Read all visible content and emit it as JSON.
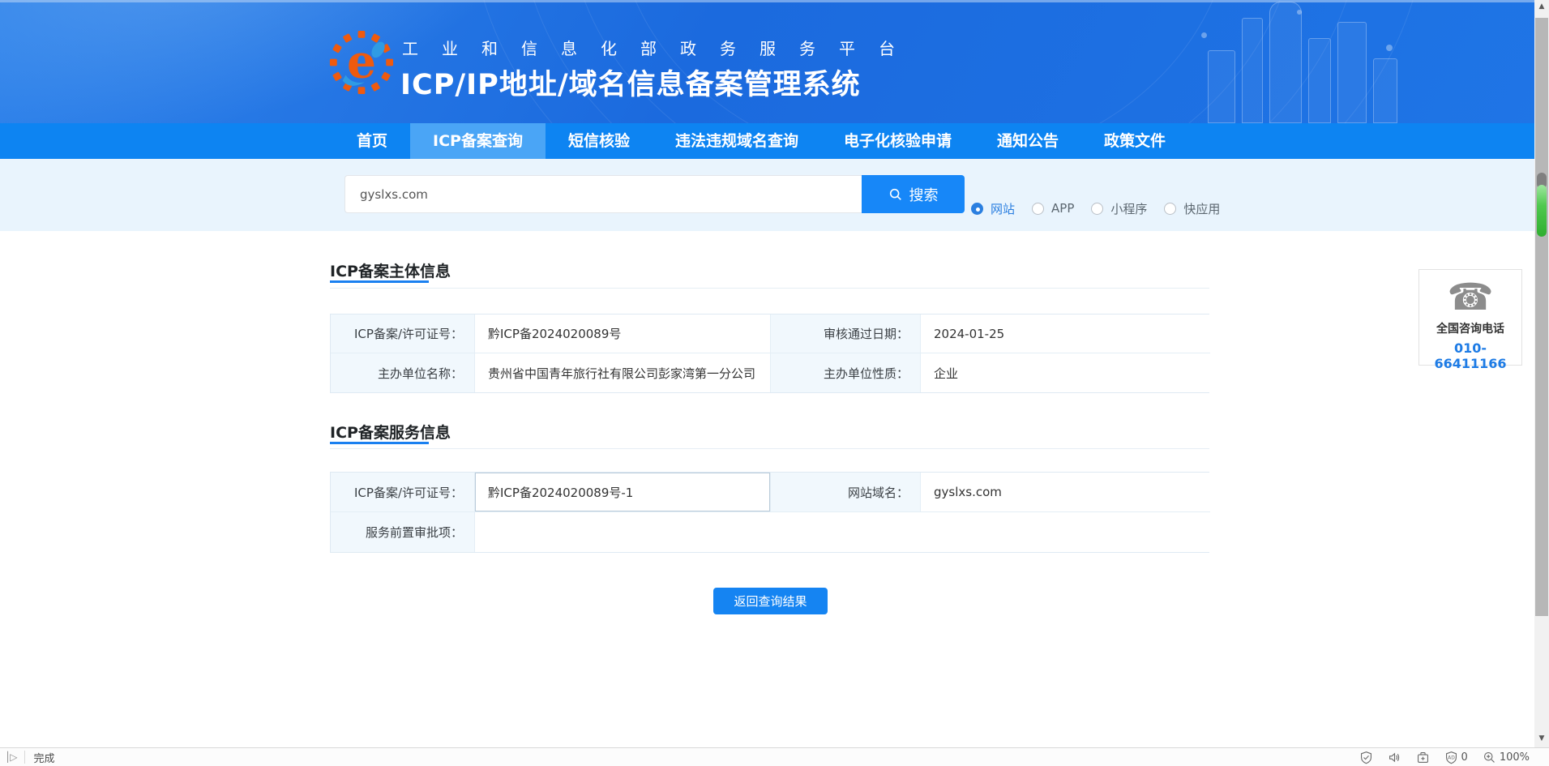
{
  "header": {
    "platform_text": "工业和信息化部政务服务平台",
    "title": "ICP/IP地址/域名信息备案管理系统"
  },
  "nav": {
    "items": [
      {
        "label": "首页",
        "active": false
      },
      {
        "label": "ICP备案查询",
        "active": true
      },
      {
        "label": "短信核验",
        "active": false
      },
      {
        "label": "违法违规域名查询",
        "active": false
      },
      {
        "label": "电子化核验申请",
        "active": false
      },
      {
        "label": "通知公告",
        "active": false
      },
      {
        "label": "政策文件",
        "active": false
      }
    ]
  },
  "search": {
    "value": "gyslxs.com",
    "button_label": "搜索",
    "types": [
      {
        "label": "网站",
        "selected": true
      },
      {
        "label": "APP",
        "selected": false
      },
      {
        "label": "小程序",
        "selected": false
      },
      {
        "label": "快应用",
        "selected": false
      }
    ]
  },
  "subject_info": {
    "title": "ICP备案主体信息",
    "license_label": "ICP备案/许可证号：",
    "license_value": "黔ICP备2024020089号",
    "audit_date_label": "审核通过日期：",
    "audit_date_value": "2024-01-25",
    "org_name_label": "主办单位名称：",
    "org_name_value": "贵州省中国青年旅行社有限公司彭家湾第一分公司",
    "org_nature_label": "主办单位性质：",
    "org_nature_value": "企业"
  },
  "service_info": {
    "title": "ICP备案服务信息",
    "license_label": "ICP备案/许可证号：",
    "license_value": "黔ICP备2024020089号-1",
    "domain_label": "网站域名：",
    "domain_value": "gyslxs.com",
    "pre_approval_label": "服务前置审批项：",
    "pre_approval_value": ""
  },
  "actions": {
    "back_button_label": "返回查询结果"
  },
  "contact": {
    "title": "全国咨询电话",
    "phone": "010-66411166",
    "phone_icon": "telephone-icon"
  },
  "statusbar": {
    "status_text": "完成",
    "ad_count": "0",
    "zoom_level": "100%"
  },
  "colors": {
    "header_blue": "#1b6ade",
    "nav_blue": "#0d84f2",
    "nav_active_blue": "#4aa5f6",
    "accent_blue": "#1584f2",
    "search_band": "#e9f4fd",
    "table_label_bg": "#f1f8fd",
    "phone_link_blue": "#1d7be5",
    "logo_orange": "#ef5a0e"
  }
}
